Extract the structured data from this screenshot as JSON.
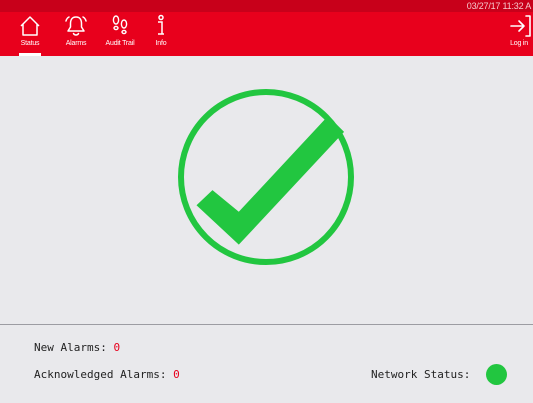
{
  "header": {
    "timestamp": "03/27/17 11:32 A",
    "nav": [
      {
        "label": "Status",
        "icon": "home-icon",
        "active": true
      },
      {
        "label": "Alarms",
        "icon": "bell-icon"
      },
      {
        "label": "Audit Trail",
        "icon": "footprints-icon"
      },
      {
        "label": "Info",
        "icon": "info-icon"
      }
    ],
    "login": {
      "label": "Log in",
      "icon": "login-icon"
    }
  },
  "main": {
    "status_icon": "checkmark-circle-icon",
    "status_color": "#22c640"
  },
  "footer": {
    "new_alarms_label": "New Alarms:",
    "new_alarms_value": "0",
    "ack_alarms_label": "Acknowledged Alarms:",
    "ack_alarms_value": "0",
    "network_status_label": "Network Status:",
    "network_status_color": "#22c640"
  },
  "colors": {
    "accent": "#e8001c",
    "background": "#e9e9ec"
  }
}
